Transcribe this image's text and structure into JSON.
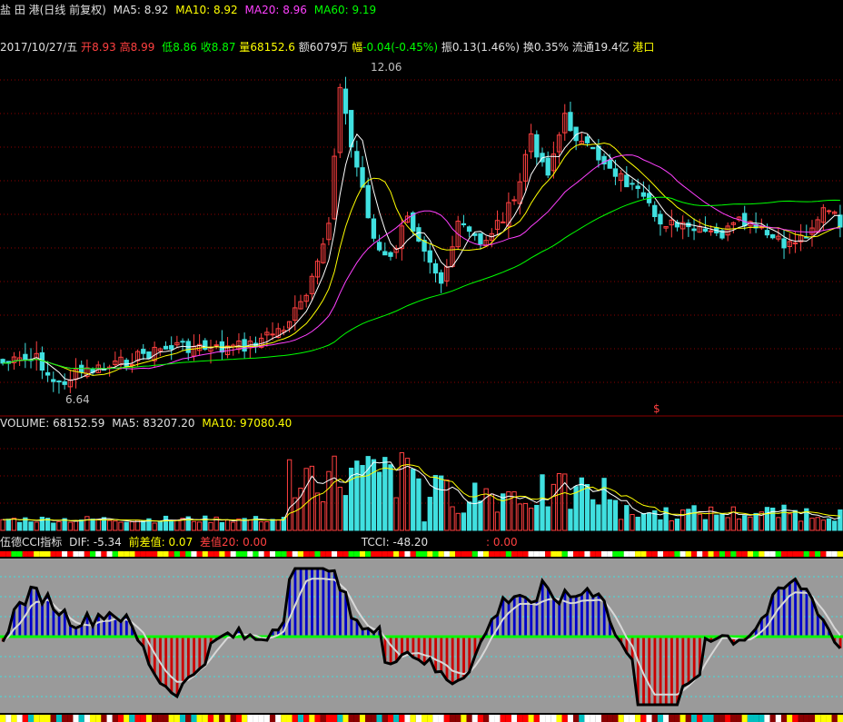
{
  "header": {
    "stock_name": "盐 田 港(日线 前复权)",
    "ma5": "MA5: 8.92",
    "ma10": "MA10: 8.92",
    "ma20": "MA20: 8.96",
    "ma60": "MA60: 9.19"
  },
  "quote": {
    "date": "2017/10/27/五",
    "open_label": "开",
    "open": "8.93",
    "high_label": "高",
    "high": "8.99",
    "low_label": "低",
    "low": "8.86",
    "close_label": "收",
    "close": "8.87",
    "vol_label": "量",
    "vol": "68152.6",
    "amount": "额6079万",
    "change_label": "幅",
    "change": "-0.04(-0.45%)",
    "amplitude": "振0.13(1.46%)",
    "turnover": "换0.35%",
    "float_cap": "流通19.4亿",
    "sector": "港口"
  },
  "price_panel": {
    "max_label": "12.06",
    "min_label": "6.64",
    "signal_label": "$"
  },
  "volume_panel": {
    "title": "VOLUME: 68152.59",
    "ma5": "MA5: 83207.20",
    "ma10": "MA10: 97080.40"
  },
  "cci_panel": {
    "title": "伍德CCI指标",
    "dif": "DIF: -5.34",
    "prev_diff": "前差值: 0.07",
    "diff20": "差值20: 0.00",
    "tcci": "TCCI: -48.20",
    "extra": ": 0.00"
  },
  "colors": {
    "up": "#ff4040",
    "down": "#40e0e0",
    "ma5": "#ffffff",
    "ma10": "#ffff00",
    "ma20": "#ff40ff",
    "ma60": "#00ff00",
    "grid": "#8b0000",
    "cci_bg": "#9a9a9a"
  }
}
